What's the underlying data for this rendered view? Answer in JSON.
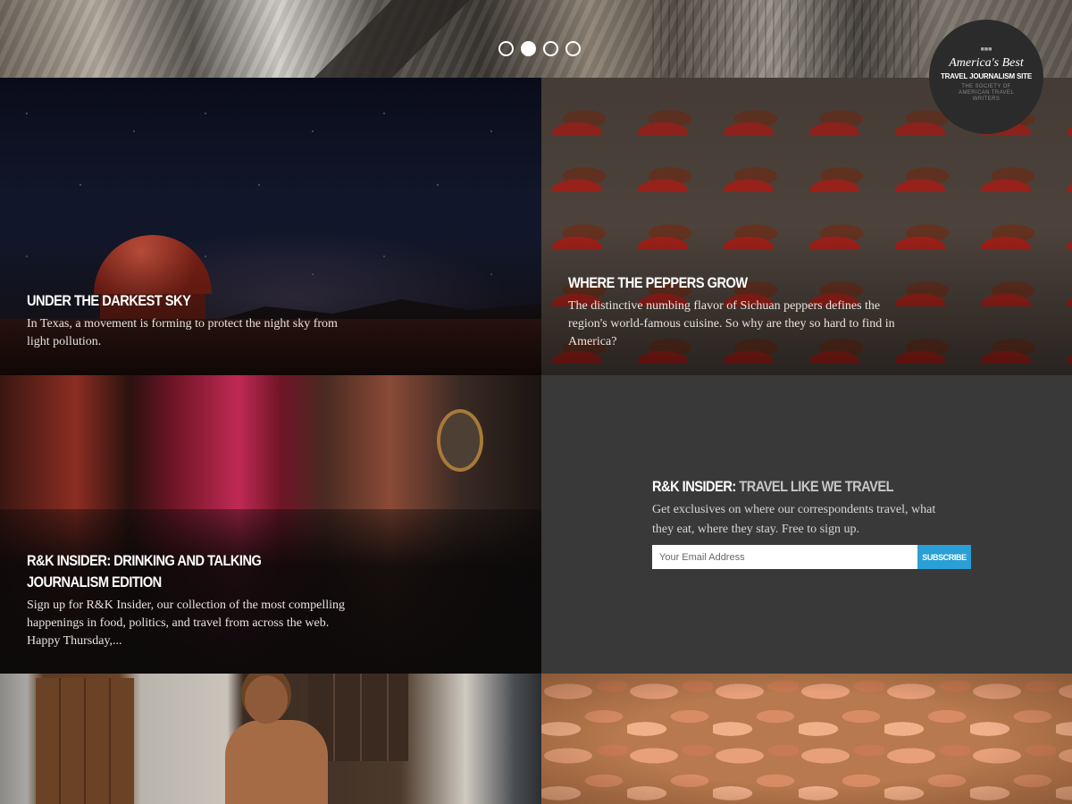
{
  "hero": {
    "slides": [
      {
        "active": false
      },
      {
        "active": true
      },
      {
        "active": false
      },
      {
        "active": false
      }
    ]
  },
  "badge": {
    "line1": "America's Best",
    "line2": "TRAVEL JOURNALISM SITE",
    "line3": "THE SOCIETY OF AMERICAN TRAVEL WRITERS"
  },
  "tiles": [
    {
      "title": "Under the Darkest Sky",
      "dek": "In Texas, a movement is forming to protect the night sky from light pollution."
    },
    {
      "title": "Where the Peppers Grow",
      "dek": "The distinctive numbing flavor of Sichuan peppers defines the region's world-famous cuisine. So why are they so hard to find in America?"
    },
    {
      "title_line1": "R&K Insider: Drinking and Talking",
      "title_line2": "Journalism Edition",
      "dek": "Sign up for R&K Insider, our collection of the most compelling happenings in food, politics, and travel from across the web. Happy Thursday,..."
    }
  ],
  "signup": {
    "title_pre": "R&K Insider:",
    "title_post": "Travel Like We Travel",
    "description": "Get exclusives on where our correspondents travel, what they eat, where they stay. Free to sign up.",
    "email_placeholder": "Your Email Address",
    "email_value": "",
    "button_label": "Subscribe",
    "button_color": "#2a9fd6"
  }
}
